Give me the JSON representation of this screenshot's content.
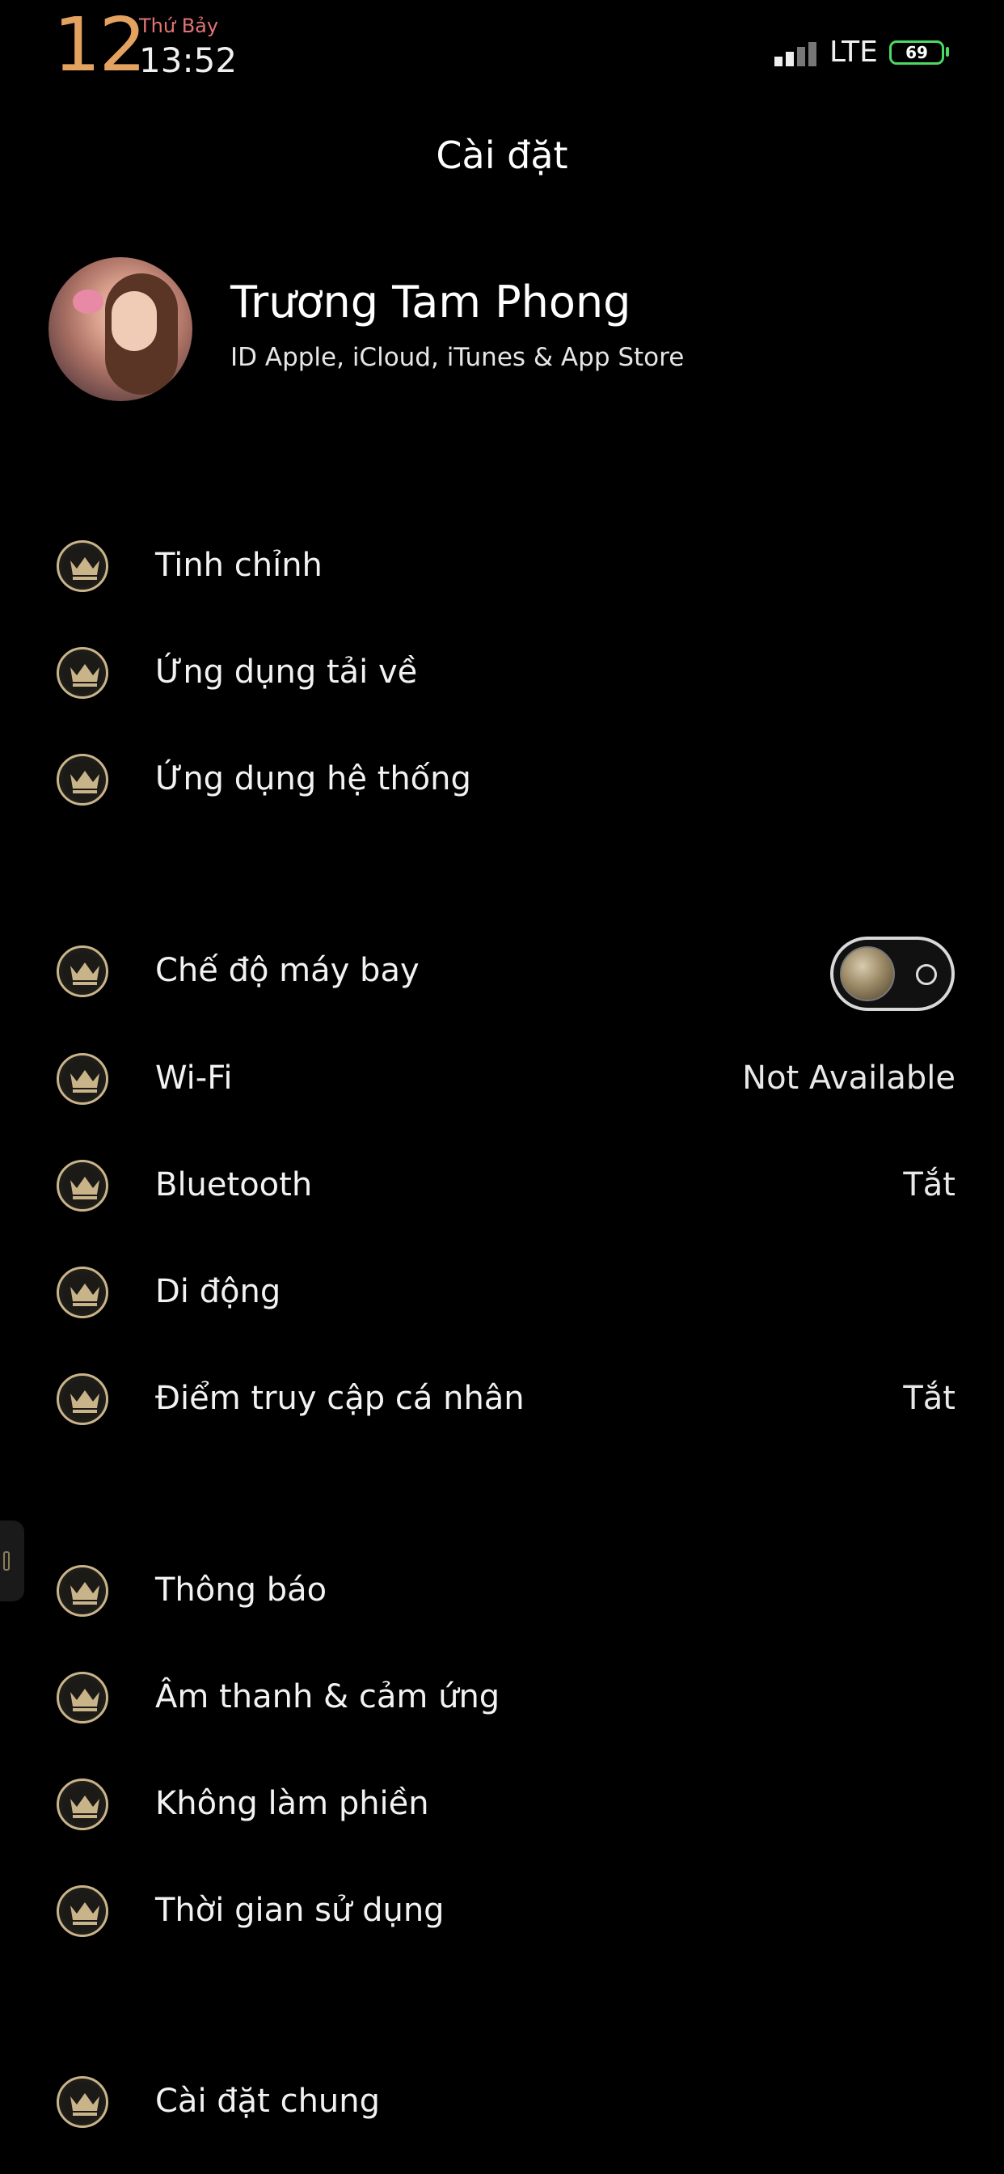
{
  "status_bar": {
    "day_number": "12",
    "weekday": "Thứ Bảy",
    "time": "13:52",
    "network": "LTE",
    "battery": "69",
    "accent_color": "#e3a260"
  },
  "header": {
    "title": "Cài đặt"
  },
  "profile": {
    "name": "Trương Tam Phong",
    "subtitle": "ID Apple, iCloud, iTunes & App Store"
  },
  "rows": {
    "tinh_chinh": {
      "label": "Tinh chỉnh",
      "icon": "crown-icon"
    },
    "ung_dung_tai_ve": {
      "label": "Ứng dụng tải về",
      "icon": "crown-icon"
    },
    "ung_dung_he_thong": {
      "label": "Ứng dụng hệ thống",
      "icon": "crown-icon"
    },
    "airplane": {
      "label": "Chế độ máy bay",
      "icon": "crown-icon",
      "toggle": "off"
    },
    "wifi": {
      "label": "Wi-Fi",
      "value": "Not Available",
      "icon": "crown-icon"
    },
    "bluetooth": {
      "label": "Bluetooth",
      "value": "Tắt",
      "icon": "crown-icon"
    },
    "di_dong": {
      "label": "Di động",
      "icon": "crown-icon"
    },
    "hotspot": {
      "label": "Điểm truy cập cá nhân",
      "value": "Tắt",
      "icon": "crown-icon"
    },
    "thong_bao": {
      "label": "Thông báo",
      "icon": "crown-icon"
    },
    "am_thanh": {
      "label": "Âm thanh & cảm ứng",
      "icon": "crown-icon"
    },
    "khong_lam_phien": {
      "label": "Không làm phiền",
      "icon": "crown-icon"
    },
    "thoi_gian": {
      "label": "Thời gian sử dụng",
      "icon": "crown-icon"
    },
    "cai_dat_chung": {
      "label": "Cài đặt chung",
      "icon": "crown-icon"
    }
  }
}
